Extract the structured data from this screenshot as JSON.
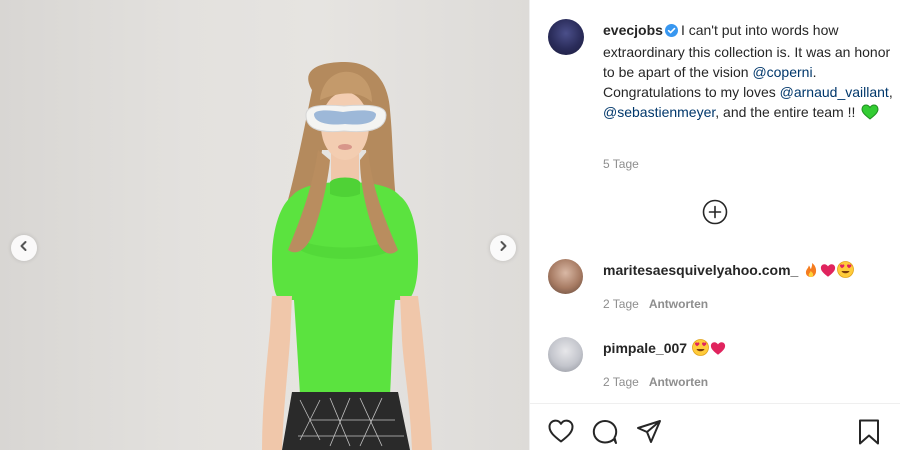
{
  "post": {
    "username": "evecjobs",
    "caption_parts": [
      "I can't put into words how extraordinary this collection is. It was an honor to be apart of the vision ",
      "@coperni",
      ". Congratulations to my loves ",
      "@arnaud_vaillant",
      ", ",
      "@sebastienmeyer",
      ", and the entire team !! "
    ],
    "time": "5 Tage"
  },
  "comments": [
    {
      "username": "maritesaesquivelyahoo.com_",
      "emojis": [
        "fire",
        "red-heart",
        "heart-eyes"
      ],
      "time": "2 Tage",
      "reply_label": "Antworten"
    },
    {
      "username": "pimpale_007",
      "emojis": [
        "heart-eyes",
        "red-heart"
      ],
      "time": "2 Tage",
      "reply_label": "Antworten"
    }
  ],
  "icons": {
    "verified": "verified-badge-icon",
    "load_more": "plus-circle-icon",
    "like": "heart-outline-icon",
    "comment": "speech-bubble-icon",
    "share": "paper-plane-icon",
    "save": "bookmark-icon",
    "prev": "chevron-left-icon",
    "next": "chevron-right-icon"
  },
  "colors": {
    "verified": "#3897f0",
    "mention": "#00376b",
    "muted": "#8e8e8e",
    "green_top": "#52e03a",
    "green_heart": "#33cc33"
  }
}
